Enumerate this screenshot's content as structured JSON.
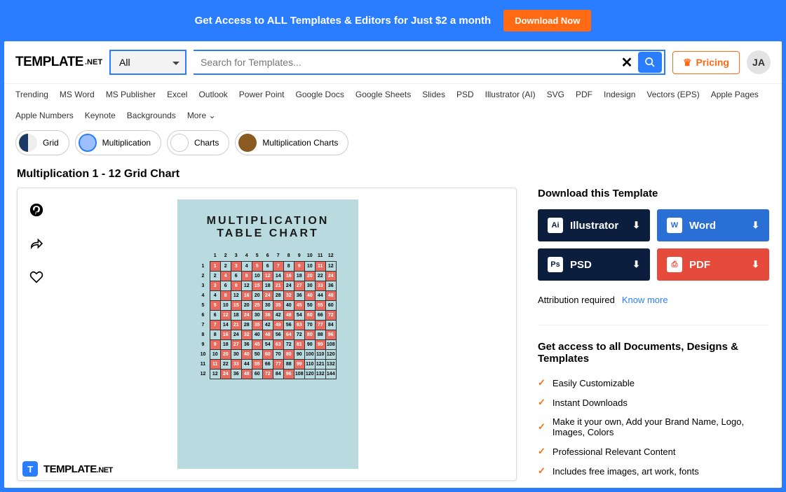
{
  "promo": {
    "text": "Get Access to ALL Templates & Editors for Just $2 a month",
    "cta": "Download Now"
  },
  "brand": {
    "name": "TEMPLATE",
    "suffix": ".NET"
  },
  "search": {
    "category": "All",
    "placeholder": "Search for Templates..."
  },
  "pricing": {
    "label": "Pricing"
  },
  "user": {
    "initials": "JA"
  },
  "tabs": [
    "Trending",
    "MS Word",
    "MS Publisher",
    "Excel",
    "Outlook",
    "Power Point",
    "Google Docs",
    "Google Sheets",
    "Slides",
    "PSD",
    "Illustrator (AI)",
    "SVG",
    "PDF",
    "Indesign",
    "Vectors (EPS)",
    "Apple Pages",
    "Apple Numbers",
    "Keynote",
    "Backgrounds",
    "More ⌄"
  ],
  "chips": [
    "Grid",
    "Multiplication",
    "Charts",
    "Multiplication Charts"
  ],
  "page": {
    "title": "Multiplication 1 - 12 Grid Chart"
  },
  "preview": {
    "line1": "MULTIPLICATION",
    "line2": "TABLE CHART"
  },
  "download": {
    "heading": "Download this Template",
    "buttons": [
      {
        "label": "Illustrator",
        "cls": "ai",
        "ic": "Ai"
      },
      {
        "label": "Word",
        "cls": "wd",
        "ic": "W"
      },
      {
        "label": "PSD",
        "cls": "ps",
        "ic": "Ps"
      },
      {
        "label": "PDF",
        "cls": "pd",
        "ic": "⎙"
      }
    ],
    "attr": "Attribution required",
    "know": "Know more"
  },
  "features": {
    "heading": "Get access to all Documents, Designs & Templates",
    "items": [
      "Easily Customizable",
      "Instant Downloads",
      "Make it your own, Add your Brand Name, Logo, Images, Colors",
      "Professional Relevant Content",
      "Includes free images, art work, fonts"
    ]
  },
  "watermark": {
    "name": "TEMPLATE",
    "suffix": ".NET"
  },
  "chart_data": {
    "type": "table",
    "title": "Multiplication 1 - 12 Grid Chart",
    "columns": [
      1,
      2,
      3,
      4,
      5,
      6,
      7,
      8,
      9,
      10,
      11,
      12
    ],
    "rows": [
      1,
      2,
      3,
      4,
      5,
      6,
      7,
      8,
      9,
      10,
      11,
      12
    ],
    "values": [
      [
        1,
        2,
        3,
        4,
        5,
        6,
        7,
        8,
        9,
        10,
        11,
        12
      ],
      [
        2,
        4,
        6,
        8,
        10,
        12,
        14,
        16,
        18,
        20,
        22,
        24
      ],
      [
        3,
        6,
        9,
        12,
        15,
        18,
        21,
        24,
        27,
        30,
        33,
        36
      ],
      [
        4,
        8,
        12,
        16,
        20,
        24,
        28,
        32,
        36,
        40,
        44,
        48
      ],
      [
        5,
        10,
        15,
        20,
        25,
        30,
        35,
        40,
        45,
        50,
        55,
        60
      ],
      [
        6,
        12,
        18,
        24,
        30,
        36,
        42,
        48,
        54,
        60,
        66,
        72
      ],
      [
        7,
        14,
        21,
        28,
        35,
        42,
        49,
        56,
        63,
        70,
        77,
        84
      ],
      [
        8,
        16,
        24,
        32,
        40,
        48,
        56,
        64,
        72,
        80,
        88,
        96
      ],
      [
        9,
        18,
        27,
        36,
        45,
        54,
        63,
        72,
        81,
        90,
        99,
        108
      ],
      [
        10,
        20,
        30,
        40,
        50,
        60,
        70,
        80,
        90,
        100,
        110,
        120
      ],
      [
        11,
        22,
        33,
        44,
        55,
        66,
        77,
        88,
        99,
        110,
        121,
        132
      ],
      [
        12,
        24,
        36,
        48,
        60,
        72,
        84,
        96,
        108,
        120,
        132,
        144
      ]
    ],
    "highlight_diagonal": true
  }
}
